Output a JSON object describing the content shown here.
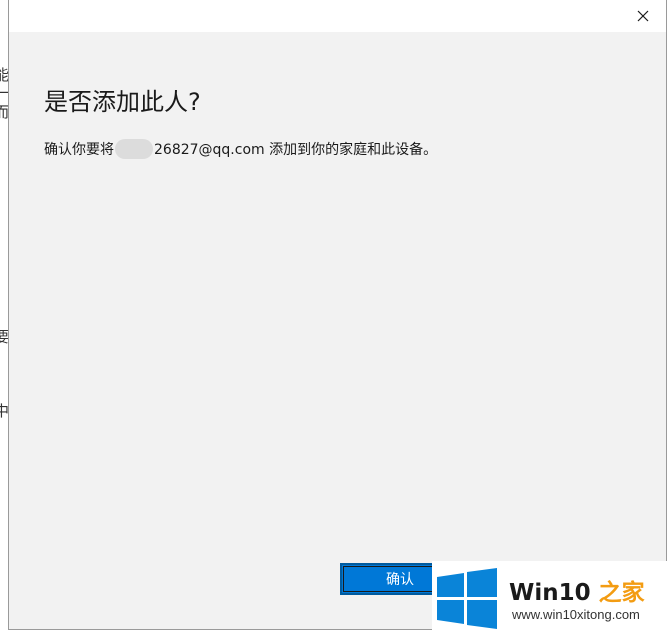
{
  "background_window": {
    "fragments": [
      "能",
      "一",
      "而",
      "要",
      "中"
    ]
  },
  "dialog": {
    "close_icon": "close-icon",
    "title": "是否添加此人?",
    "message_prefix": "确认你要将",
    "message_email_suffix": "26827@qq.com",
    "message_rest": " 添加到你的家庭和此设备。",
    "confirm_label": "确认"
  },
  "watermark": {
    "brand_main": "Win10 ",
    "brand_accent": "之家",
    "url": "www.win10xitong.com",
    "logo_icon": "windows-logo-icon",
    "colors": {
      "logo_blue": "#0078d7",
      "accent": "#f39c12"
    }
  },
  "colors": {
    "dialog_bg": "#f2f2f2",
    "titlebar_bg": "#ffffff",
    "button_blue": "#0078d7"
  }
}
